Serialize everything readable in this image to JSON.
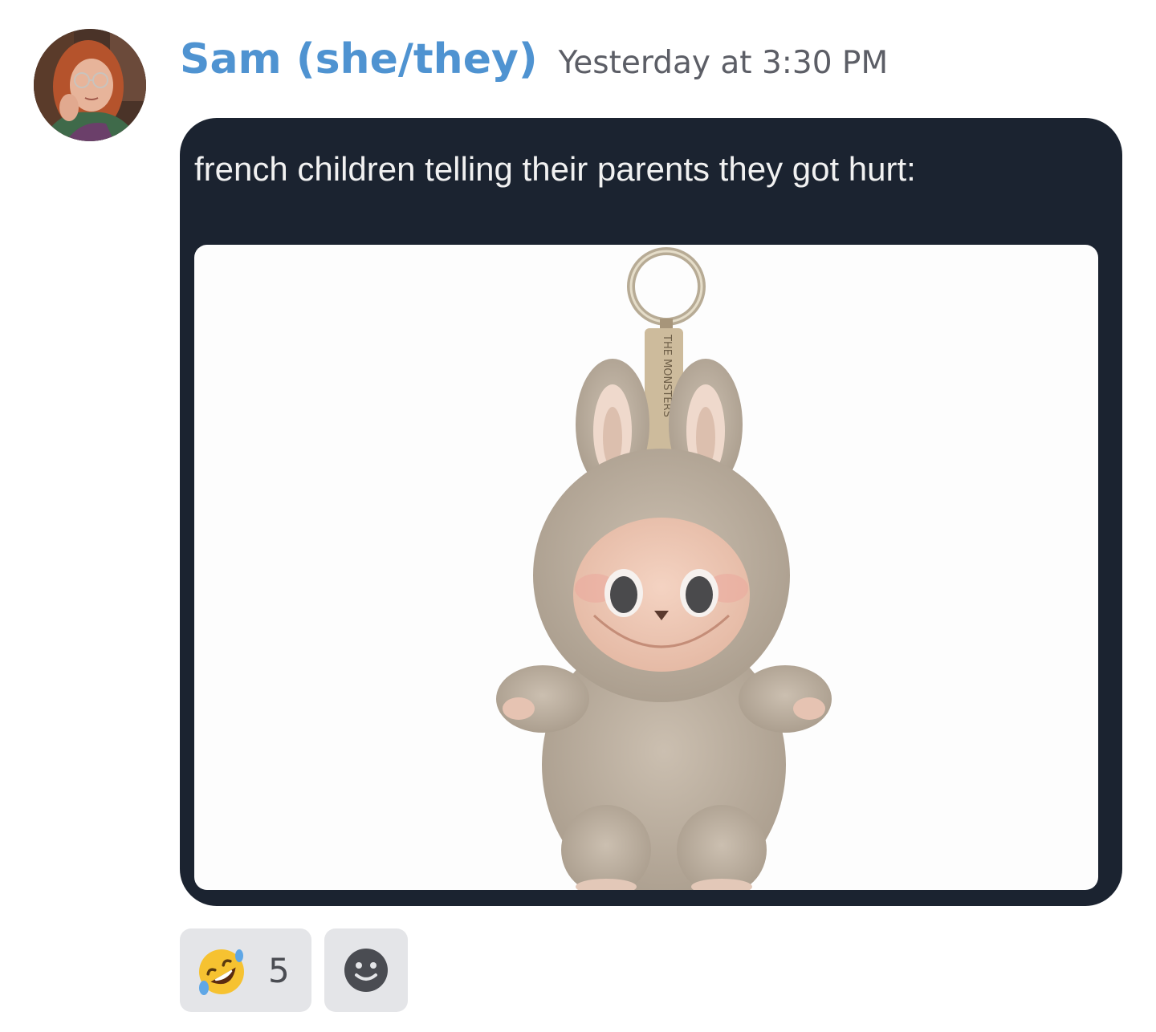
{
  "message": {
    "author": "Sam (she/they)",
    "timestamp": "Yesterday at 3:30 PM",
    "avatar_icon": "user-avatar",
    "author_color": "#4f93d1"
  },
  "attachment": {
    "caption": "french children telling their parents they got hurt:",
    "photo_subject": "plush keychain toy",
    "strap_text": "THE MONSTERS",
    "background": "#1b2330"
  },
  "reactions": [
    {
      "emoji": "rolling-on-floor-laughing-icon",
      "count": "5"
    },
    {
      "emoji": "add-reaction-smiley-icon"
    }
  ]
}
